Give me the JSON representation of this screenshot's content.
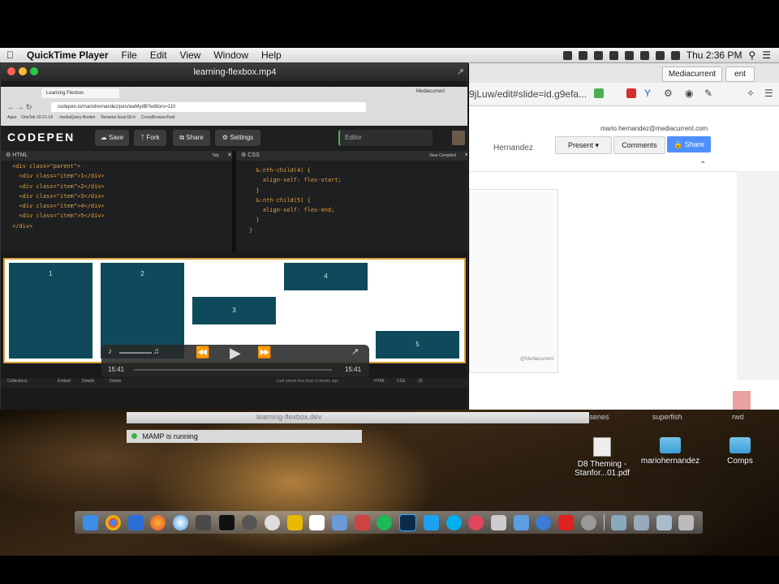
{
  "menubar": {
    "app": "QuickTime Player",
    "items": [
      "File",
      "Edit",
      "View",
      "Window",
      "Help"
    ],
    "clock": "Thu 2:36 PM"
  },
  "quicktime": {
    "title": "learning-flexbox.mp4",
    "time_elapsed": "15:41",
    "time_remaining": "15:41"
  },
  "browser": {
    "tab_title": "Learning Flexbox",
    "url": "codepen.io/mariohernandez/pen/waMydB?editors=110",
    "bookmarks": [
      "Apps",
      "OneTab 10-21-14",
      "mediaQuery Bookm",
      "Rename local Git b",
      "CrossBrowserTesti"
    ],
    "profile": "Mediacurrent"
  },
  "codepen": {
    "logo": "CODEPEN",
    "buttons": [
      "Save",
      "Fork",
      "Share",
      "Settings"
    ],
    "editor_label": "Editor",
    "html_label": "HTML",
    "css_label": "CSS",
    "tidy": "Tidy",
    "view_compiled": "View Compiled",
    "html_code": "<div class=\"parent\">\n  <div class=\"item\">1</div>\n  <div class=\"item\">2</div>\n  <div class=\"item\">3</div>\n  <div class=\"item\">4</div>\n  <div class=\"item\">5</div>\n</div>",
    "css_code": "  &:nth-child(4) {\n    align-self: flex-start;\n  }\n  &:nth-child(5) {\n    align-self: flex-end;\n  }\n}",
    "preview_items": [
      "1",
      "2",
      "3",
      "4",
      "5"
    ],
    "footer": [
      "Collections",
      "Embed",
      "Details",
      "Delete"
    ],
    "footer_status": "Last saved less than a minute ago",
    "footer_tabs": [
      "HTML",
      "CSS",
      "JS"
    ]
  },
  "slides": {
    "url": "9jLuw/edit#slide=id.g9efa...",
    "profile": "Mediacurrent",
    "profile_edge": "ent",
    "email": "mario.hernandez@mediacurrent.com",
    "owner": "Hernandez",
    "present": "Present",
    "comments": "Comments",
    "share": "Share",
    "handle": "@Mediacurrent"
  },
  "finder": {
    "window_title": "learning-flexbox.dev",
    "mamp_status": "MAMP is running",
    "partial_labels": [
      "cisenes",
      "superfish",
      "rwd"
    ]
  },
  "desktop_icons": [
    {
      "label": "D8 Theming - Stanfor...01.pdf",
      "kind": "pdf"
    },
    {
      "label": "mariohernandez",
      "kind": "folder"
    },
    {
      "label": "Comps",
      "kind": "folder"
    }
  ],
  "dock": [
    "finder-icon",
    "chrome-icon",
    "firefox-icon",
    "safari-icon",
    "sublime-icon",
    "terminal-icon",
    "mamp-icon",
    "github-icon",
    "chat-icon",
    "calendar-icon",
    "virtualbox-icon",
    "sequel-icon",
    "spotify-icon",
    "photoshop-icon",
    "twitter-icon",
    "skype-icon",
    "slack-icon",
    "quicktime-icon",
    "screenflow-icon",
    "airdrop-icon",
    "adobe-icon",
    "settings-icon",
    "downloads-icon",
    "applications-icon",
    "documents-icon",
    "trash-icon"
  ],
  "colors": {
    "flex_item": "#0e4a5c",
    "preview_border": "#d9a23c",
    "share_blue": "#4d90fe"
  }
}
